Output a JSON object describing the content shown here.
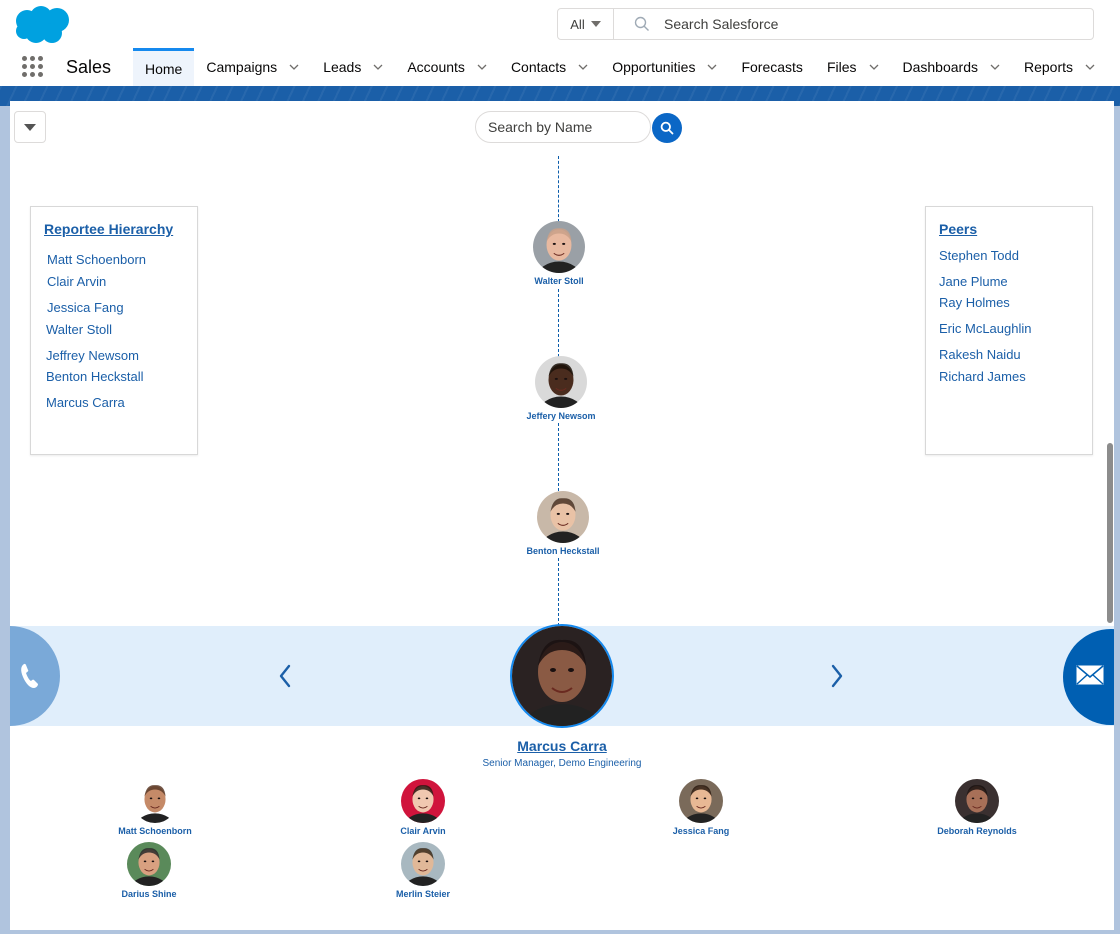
{
  "header": {
    "logo": "salesforce-cloud-logo",
    "search_scope": "All",
    "search_placeholder": "Search Salesforce",
    "app_name": "Sales"
  },
  "nav": {
    "tabs": [
      {
        "label": "Home",
        "active": true,
        "dropdown": false
      },
      {
        "label": "Campaigns",
        "dropdown": true
      },
      {
        "label": "Leads",
        "dropdown": true
      },
      {
        "label": "Accounts",
        "dropdown": true
      },
      {
        "label": "Contacts",
        "dropdown": true
      },
      {
        "label": "Opportunities",
        "dropdown": true
      },
      {
        "label": "Forecasts",
        "dropdown": false
      },
      {
        "label": "Files",
        "dropdown": true
      },
      {
        "label": "Dashboards",
        "dropdown": true
      },
      {
        "label": "Reports",
        "dropdown": true
      }
    ]
  },
  "main": {
    "name_search_placeholder": "Search by Name",
    "reportee_panel": {
      "title": "Reportee Hierarchy",
      "items": [
        "Matt Schoenborn",
        "Clair Arvin",
        "Jessica Fang",
        "Walter Stoll",
        "Jeffrey Newsom",
        "Benton Heckstall",
        "Marcus Carra"
      ]
    },
    "peers_panel": {
      "title": "Peers",
      "items": [
        "Stephen Todd",
        "Jane Plume",
        "Ray Holmes",
        "Eric McLaughlin",
        "Rakesh Naidu",
        "Richard James"
      ]
    },
    "chain": [
      {
        "name": "Walter Stoll",
        "skin": "#e8b9a0",
        "bg": "#9aa0a6",
        "hair": "#c9a088"
      },
      {
        "name": "Jeffery Newsom",
        "skin": "#4a2c1e",
        "bg": "#d9d9d9",
        "hair": "#1a1008"
      },
      {
        "name": "Benton Heckstall",
        "skin": "#e9c2a6",
        "bg": "#c8b8a8",
        "hair": "#4a3426"
      }
    ],
    "focus": {
      "name": "Marcus Carra",
      "title": "Senior Manager, Demo Engineering",
      "skin": "#8a5a44",
      "bg": "#2a2222"
    },
    "reports": [
      {
        "name": "Matt Schoenborn",
        "skin": "#c58a68",
        "bg": "#ffffff",
        "hair": "#5a3a28"
      },
      {
        "name": "Clair Arvin",
        "skin": "#f0c8b0",
        "bg": "#d0143c",
        "hair": "#2a1810"
      },
      {
        "name": "Jessica Fang",
        "skin": "#e8b894",
        "bg": "#7a6a5a",
        "hair": "#2a1a10"
      },
      {
        "name": "Deborah Reynolds",
        "skin": "#a87058",
        "bg": "#3a3030",
        "hair": "#1a1210"
      },
      {
        "name": "Darius Shine",
        "skin": "#d8a080",
        "bg": "#5a8a5a",
        "hair": "#2a2a2a"
      },
      {
        "name": "Merlin Steier",
        "skin": "#e0b898",
        "bg": "#a8b8c0",
        "hair": "#3a2a1a"
      }
    ]
  },
  "colors": {
    "brand": "#00a1e0",
    "link": "#1b5fa8",
    "action": "#0b67c6",
    "focus_band": "#e0eefb"
  }
}
